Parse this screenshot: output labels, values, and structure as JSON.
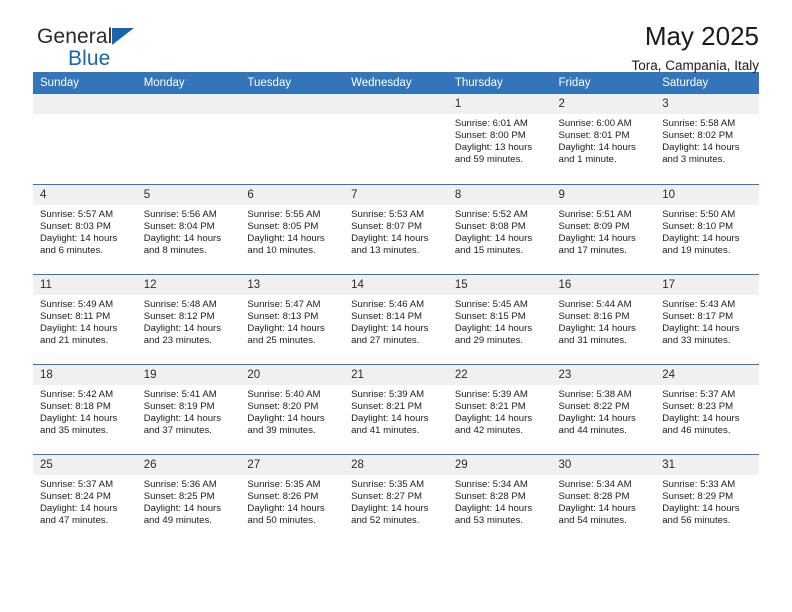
{
  "brand": {
    "line1": "General",
    "line2": "Blue",
    "triangle_color": "#1567b2"
  },
  "header": {
    "title": "May 2025",
    "subtitle": "Tora, Campania, Italy"
  },
  "theme": {
    "header_bg": "#3275bb",
    "daynum_bg": "#f0f0f0",
    "text": "#1c1c1c"
  },
  "weekdays": [
    "Sunday",
    "Monday",
    "Tuesday",
    "Wednesday",
    "Thursday",
    "Friday",
    "Saturday"
  ],
  "weeks": [
    [
      {
        "day": "",
        "sunrise": "",
        "sunset": "",
        "daylight": ""
      },
      {
        "day": "",
        "sunrise": "",
        "sunset": "",
        "daylight": ""
      },
      {
        "day": "",
        "sunrise": "",
        "sunset": "",
        "daylight": ""
      },
      {
        "day": "",
        "sunrise": "",
        "sunset": "",
        "daylight": ""
      },
      {
        "day": "1",
        "sunrise": "Sunrise: 6:01 AM",
        "sunset": "Sunset: 8:00 PM",
        "daylight": "Daylight: 13 hours and 59 minutes."
      },
      {
        "day": "2",
        "sunrise": "Sunrise: 6:00 AM",
        "sunset": "Sunset: 8:01 PM",
        "daylight": "Daylight: 14 hours and 1 minute."
      },
      {
        "day": "3",
        "sunrise": "Sunrise: 5:58 AM",
        "sunset": "Sunset: 8:02 PM",
        "daylight": "Daylight: 14 hours and 3 minutes."
      }
    ],
    [
      {
        "day": "4",
        "sunrise": "Sunrise: 5:57 AM",
        "sunset": "Sunset: 8:03 PM",
        "daylight": "Daylight: 14 hours and 6 minutes."
      },
      {
        "day": "5",
        "sunrise": "Sunrise: 5:56 AM",
        "sunset": "Sunset: 8:04 PM",
        "daylight": "Daylight: 14 hours and 8 minutes."
      },
      {
        "day": "6",
        "sunrise": "Sunrise: 5:55 AM",
        "sunset": "Sunset: 8:05 PM",
        "daylight": "Daylight: 14 hours and 10 minutes."
      },
      {
        "day": "7",
        "sunrise": "Sunrise: 5:53 AM",
        "sunset": "Sunset: 8:07 PM",
        "daylight": "Daylight: 14 hours and 13 minutes."
      },
      {
        "day": "8",
        "sunrise": "Sunrise: 5:52 AM",
        "sunset": "Sunset: 8:08 PM",
        "daylight": "Daylight: 14 hours and 15 minutes."
      },
      {
        "day": "9",
        "sunrise": "Sunrise: 5:51 AM",
        "sunset": "Sunset: 8:09 PM",
        "daylight": "Daylight: 14 hours and 17 minutes."
      },
      {
        "day": "10",
        "sunrise": "Sunrise: 5:50 AM",
        "sunset": "Sunset: 8:10 PM",
        "daylight": "Daylight: 14 hours and 19 minutes."
      }
    ],
    [
      {
        "day": "11",
        "sunrise": "Sunrise: 5:49 AM",
        "sunset": "Sunset: 8:11 PM",
        "daylight": "Daylight: 14 hours and 21 minutes."
      },
      {
        "day": "12",
        "sunrise": "Sunrise: 5:48 AM",
        "sunset": "Sunset: 8:12 PM",
        "daylight": "Daylight: 14 hours and 23 minutes."
      },
      {
        "day": "13",
        "sunrise": "Sunrise: 5:47 AM",
        "sunset": "Sunset: 8:13 PM",
        "daylight": "Daylight: 14 hours and 25 minutes."
      },
      {
        "day": "14",
        "sunrise": "Sunrise: 5:46 AM",
        "sunset": "Sunset: 8:14 PM",
        "daylight": "Daylight: 14 hours and 27 minutes."
      },
      {
        "day": "15",
        "sunrise": "Sunrise: 5:45 AM",
        "sunset": "Sunset: 8:15 PM",
        "daylight": "Daylight: 14 hours and 29 minutes."
      },
      {
        "day": "16",
        "sunrise": "Sunrise: 5:44 AM",
        "sunset": "Sunset: 8:16 PM",
        "daylight": "Daylight: 14 hours and 31 minutes."
      },
      {
        "day": "17",
        "sunrise": "Sunrise: 5:43 AM",
        "sunset": "Sunset: 8:17 PM",
        "daylight": "Daylight: 14 hours and 33 minutes."
      }
    ],
    [
      {
        "day": "18",
        "sunrise": "Sunrise: 5:42 AM",
        "sunset": "Sunset: 8:18 PM",
        "daylight": "Daylight: 14 hours and 35 minutes."
      },
      {
        "day": "19",
        "sunrise": "Sunrise: 5:41 AM",
        "sunset": "Sunset: 8:19 PM",
        "daylight": "Daylight: 14 hours and 37 minutes."
      },
      {
        "day": "20",
        "sunrise": "Sunrise: 5:40 AM",
        "sunset": "Sunset: 8:20 PM",
        "daylight": "Daylight: 14 hours and 39 minutes."
      },
      {
        "day": "21",
        "sunrise": "Sunrise: 5:39 AM",
        "sunset": "Sunset: 8:21 PM",
        "daylight": "Daylight: 14 hours and 41 minutes."
      },
      {
        "day": "22",
        "sunrise": "Sunrise: 5:39 AM",
        "sunset": "Sunset: 8:21 PM",
        "daylight": "Daylight: 14 hours and 42 minutes."
      },
      {
        "day": "23",
        "sunrise": "Sunrise: 5:38 AM",
        "sunset": "Sunset: 8:22 PM",
        "daylight": "Daylight: 14 hours and 44 minutes."
      },
      {
        "day": "24",
        "sunrise": "Sunrise: 5:37 AM",
        "sunset": "Sunset: 8:23 PM",
        "daylight": "Daylight: 14 hours and 46 minutes."
      }
    ],
    [
      {
        "day": "25",
        "sunrise": "Sunrise: 5:37 AM",
        "sunset": "Sunset: 8:24 PM",
        "daylight": "Daylight: 14 hours and 47 minutes."
      },
      {
        "day": "26",
        "sunrise": "Sunrise: 5:36 AM",
        "sunset": "Sunset: 8:25 PM",
        "daylight": "Daylight: 14 hours and 49 minutes."
      },
      {
        "day": "27",
        "sunrise": "Sunrise: 5:35 AM",
        "sunset": "Sunset: 8:26 PM",
        "daylight": "Daylight: 14 hours and 50 minutes."
      },
      {
        "day": "28",
        "sunrise": "Sunrise: 5:35 AM",
        "sunset": "Sunset: 8:27 PM",
        "daylight": "Daylight: 14 hours and 52 minutes."
      },
      {
        "day": "29",
        "sunrise": "Sunrise: 5:34 AM",
        "sunset": "Sunset: 8:28 PM",
        "daylight": "Daylight: 14 hours and 53 minutes."
      },
      {
        "day": "30",
        "sunrise": "Sunrise: 5:34 AM",
        "sunset": "Sunset: 8:28 PM",
        "daylight": "Daylight: 14 hours and 54 minutes."
      },
      {
        "day": "31",
        "sunrise": "Sunrise: 5:33 AM",
        "sunset": "Sunset: 8:29 PM",
        "daylight": "Daylight: 14 hours and 56 minutes."
      }
    ]
  ]
}
